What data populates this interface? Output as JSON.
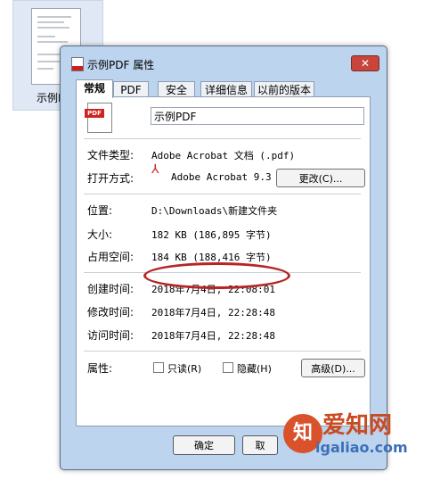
{
  "background_file": {
    "caption": "示例P"
  },
  "window": {
    "title": "示例PDF 属性",
    "close_glyph": "✕"
  },
  "tabs": [
    {
      "label": "常规",
      "active": true
    },
    {
      "label": "PDF"
    },
    {
      "label": "安全"
    },
    {
      "label": "详细信息"
    },
    {
      "label": "以前的版本"
    }
  ],
  "general": {
    "icon_label": "PDF",
    "file_name": "示例PDF",
    "file_type_label": "文件类型:",
    "file_type_value": "Adobe Acrobat 文档 (.pdf)",
    "opens_with_label": "打开方式:",
    "opens_with_value": "Adobe Acrobat 9.3",
    "change_button": "更改(C)...",
    "location_label": "位置:",
    "location_value": "D:\\Downloads\\新建文件夹",
    "size_label": "大小:",
    "size_value": "182 KB (186,895 字节)",
    "size_on_disk_label": "占用空间:",
    "size_on_disk_value": "184 KB (188,416 字节)",
    "created_label": "创建时间:",
    "created_value": "2018年7月4日, 22:08:01",
    "modified_label": "修改时间:",
    "modified_value": "2018年7月4日, 22:28:48",
    "accessed_label": "访问时间:",
    "accessed_value": "2018年7月4日, 22:28:48",
    "attributes_label": "属性:",
    "readonly_label": "只读(R)",
    "hidden_label": "隐藏(H)",
    "advanced_button": "高级(D)..."
  },
  "footer": {
    "ok_button": "确定",
    "cancel_button_partial": "取"
  },
  "watermark": {
    "title": "爱知网",
    "url": "igaliao.com"
  },
  "colors": {
    "highlight_ellipse": "#b52525",
    "pdf_red": "#d0231f"
  }
}
